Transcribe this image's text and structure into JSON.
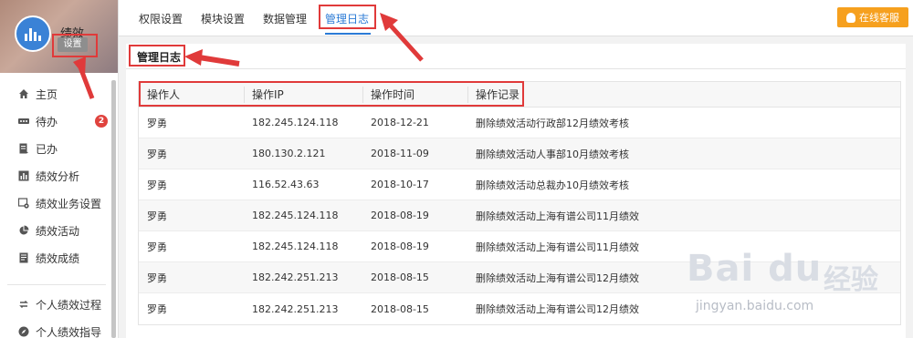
{
  "profile": {
    "name": "绩效",
    "settings_label": "设置"
  },
  "sidebar": {
    "items": [
      {
        "label": "主页",
        "icon": "home-icon"
      },
      {
        "label": "待办",
        "icon": "dots-icon",
        "badge": "2"
      },
      {
        "label": "已办",
        "icon": "document-icon"
      },
      {
        "label": "绩效分析",
        "icon": "bar-chart-icon"
      },
      {
        "label": "绩效业务设置",
        "icon": "settings-window-icon"
      },
      {
        "label": "绩效活动",
        "icon": "pie-chart-icon"
      },
      {
        "label": "绩效成绩",
        "icon": "report-icon"
      }
    ],
    "items2": [
      {
        "label": "个人绩效过程",
        "icon": "refresh-icon"
      },
      {
        "label": "个人绩效指导",
        "icon": "compass-icon"
      }
    ]
  },
  "tabs": [
    {
      "label": "权限设置"
    },
    {
      "label": "模块设置"
    },
    {
      "label": "数据管理"
    },
    {
      "label": "管理日志",
      "active": true
    }
  ],
  "service_button": "在线客服",
  "section_title": "管理日志",
  "table": {
    "headers": [
      "操作人",
      "操作IP",
      "操作时间",
      "操作记录"
    ],
    "rows": [
      [
        "罗勇",
        "182.245.124.118",
        "2018-12-21",
        "删除绩效活动行政部12月绩效考核"
      ],
      [
        "罗勇",
        "180.130.2.121",
        "2018-11-09",
        "删除绩效活动人事部10月绩效考核"
      ],
      [
        "罗勇",
        "116.52.43.63",
        "2018-10-17",
        "删除绩效活动总裁办10月绩效考核"
      ],
      [
        "罗勇",
        "182.245.124.118",
        "2018-08-19",
        "删除绩效活动上海有谱公司11月绩效"
      ],
      [
        "罗勇",
        "182.245.124.118",
        "2018-08-19",
        "删除绩效活动上海有谱公司11月绩效"
      ],
      [
        "罗勇",
        "182.242.251.213",
        "2018-08-15",
        "删除绩效活动上海有谱公司12月绩效"
      ],
      [
        "罗勇",
        "182.242.251.213",
        "2018-08-15",
        "删除绩效活动上海有谱公司12月绩效"
      ]
    ]
  },
  "watermark": {
    "brand": "Bai du",
    "brand_cn": "经验",
    "url": "jingyan.baidu.com"
  },
  "colors": {
    "accent": "#2b7bd6",
    "highlight": "#e03a3a",
    "service": "#f6a01e",
    "badge": "#e0433e"
  }
}
